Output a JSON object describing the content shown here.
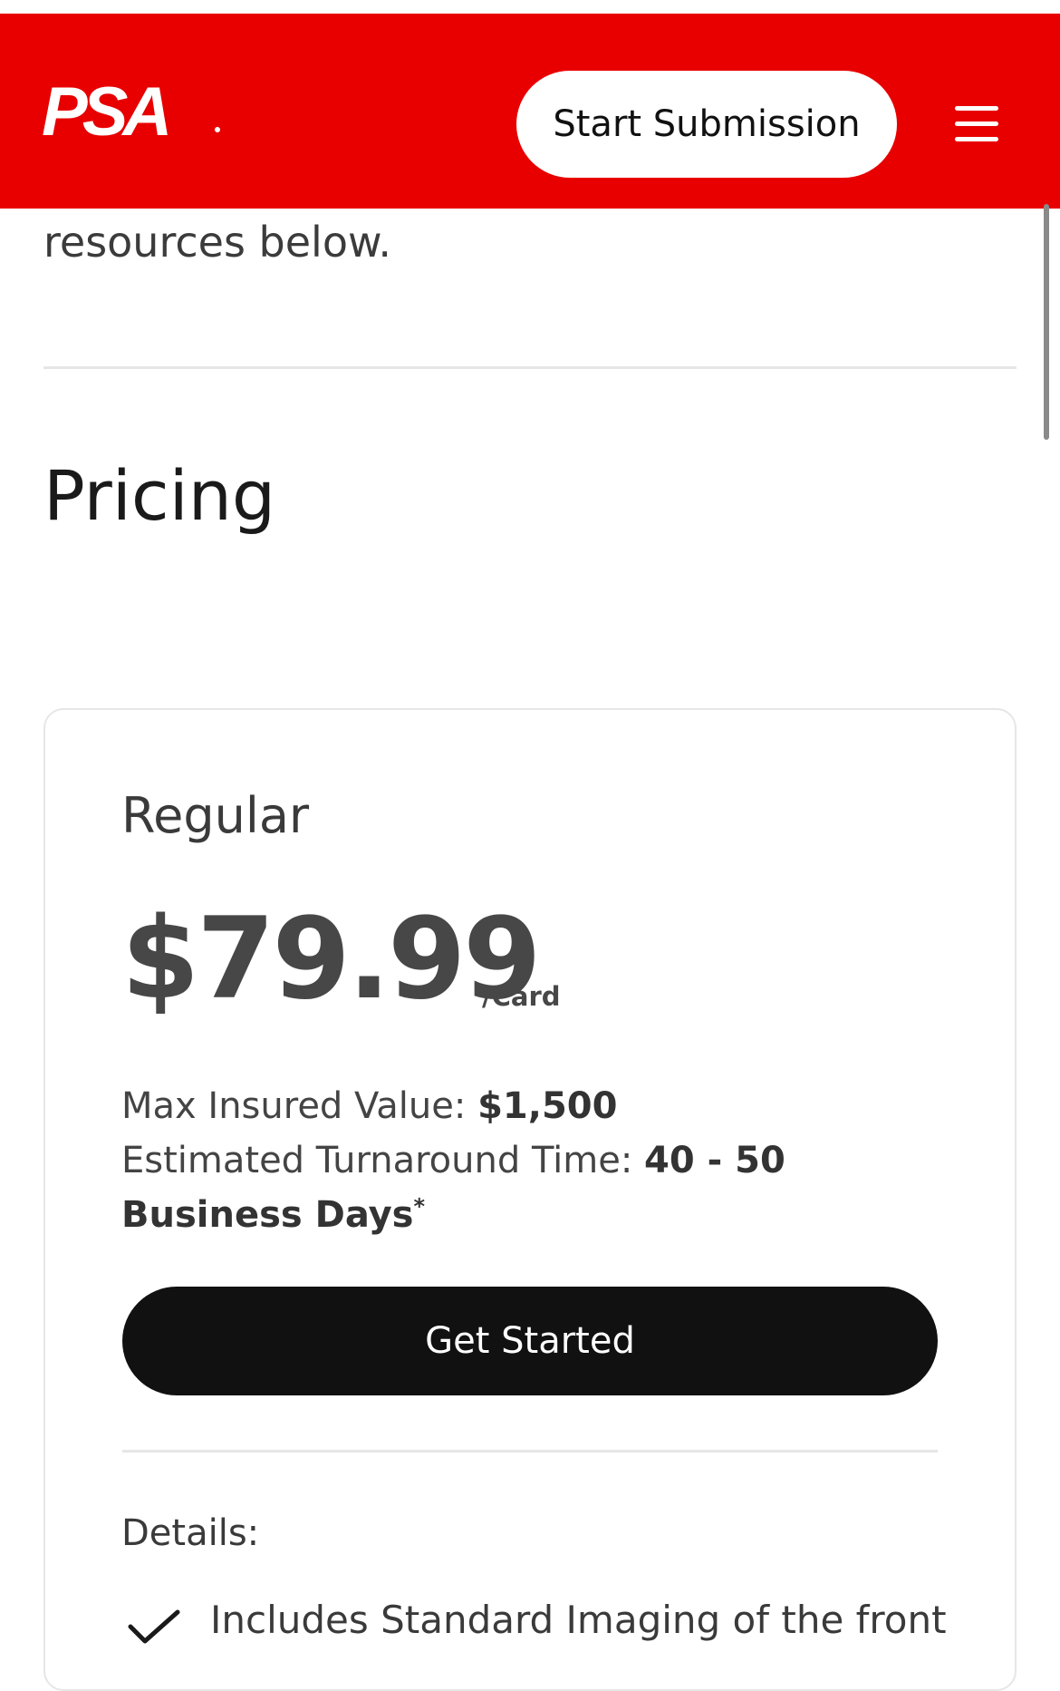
{
  "header": {
    "logo_text": "PSA",
    "start_submission_label": "Start Submission",
    "menu_icon": "hamburger-menu-icon",
    "background_color": "#e80000"
  },
  "intro": {
    "text": "resources below."
  },
  "pricing": {
    "title": "Pricing",
    "plan": {
      "name": "Regular",
      "price": "$79.99",
      "price_unit": "/Card",
      "max_insured_label": "Max Insured Value:",
      "max_insured_value": "$1,500",
      "turnaround_label": "Estimated Turnaround Time:",
      "turnaround_value_line1": "40 - 50",
      "turnaround_value_line2": "Business Days",
      "turnaround_footnote": "*",
      "cta_label": "Get Started",
      "details_label": "Details:",
      "features": [
        {
          "icon": "checkmark-icon",
          "text": "Includes Standard Imaging of the front"
        }
      ]
    }
  }
}
